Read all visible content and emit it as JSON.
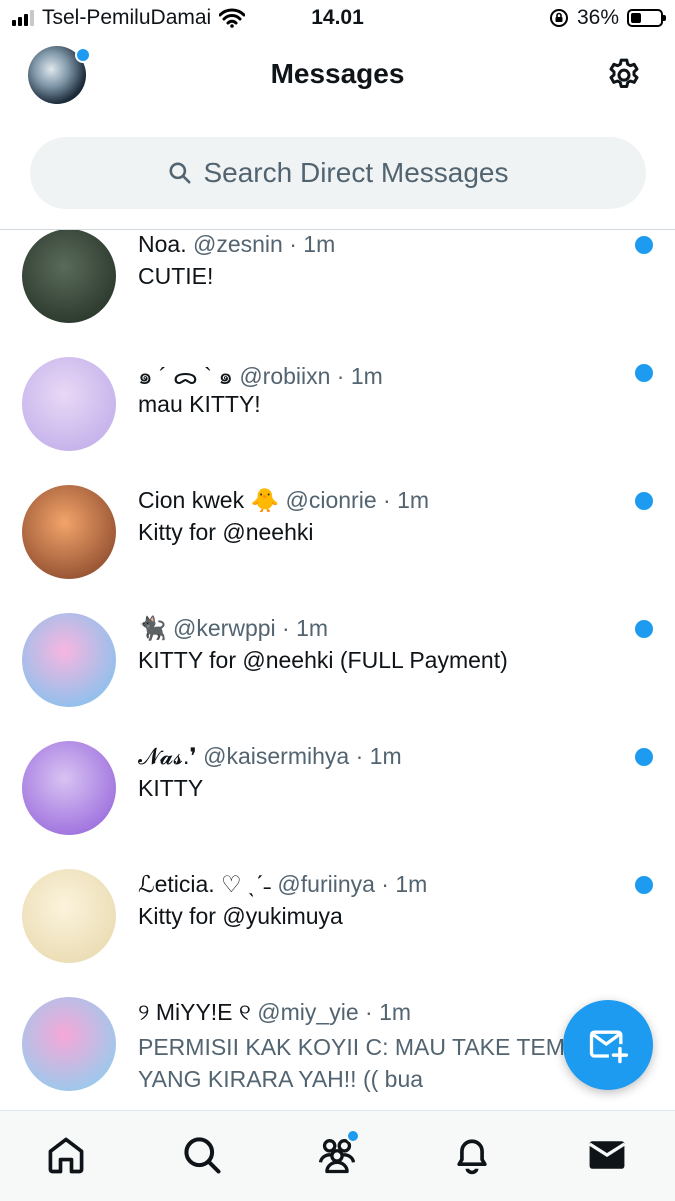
{
  "status_bar": {
    "carrier": "Tsel-PemiluDamai",
    "time": "14.01",
    "battery": "36%",
    "battery_level": 0.36
  },
  "header": {
    "title": "Messages"
  },
  "search": {
    "placeholder": "Search Direct Messages"
  },
  "conversations": [
    {
      "name": "Noa.",
      "handle": "@zesnin",
      "time": "1m",
      "preview": "CUTIE!",
      "unread": true,
      "avatar_colors": [
        "#5a6b5a",
        "#1e2a20"
      ]
    },
    {
      "name": "๑ ´ ᯅ ` ๑",
      "handle": "@robiixn",
      "time": "1m",
      "preview": "mau KITTY!",
      "unread": true,
      "avatar_colors": [
        "#e9d8f5",
        "#b9a7e8"
      ]
    },
    {
      "name": "Cion kwek 🐥",
      "handle": "@cionrie",
      "time": "1m",
      "preview": "Kitty for @neehki",
      "unread": true,
      "avatar_colors": [
        "#f2a46a",
        "#7a3a22"
      ]
    },
    {
      "name": "🐈‍⬛",
      "handle": "@kerwppi",
      "time": "1m",
      "preview": "KITTY for @neehki (FULL Payment)",
      "unread": true,
      "avatar_colors": [
        "#f7b6e0",
        "#6fc3f0"
      ]
    },
    {
      "name": "𝓝𝓪𝓼.❜",
      "handle": "@kaisermihya",
      "time": "1m",
      "preview": "KITTY",
      "unread": true,
      "avatar_colors": [
        "#d8c3f3",
        "#8e5ad8"
      ]
    },
    {
      "name": "ℒeticia. ♡ ˎˊ˗",
      "handle": "@furiinya",
      "time": "1m",
      "preview": "Kitty for @yukimuya",
      "unread": true,
      "avatar_colors": [
        "#fbf3dc",
        "#e6d6a8"
      ]
    },
    {
      "name": "୨ MiYY!E ୧",
      "handle": "@miy_yie",
      "time": "1m",
      "preview": "PERMISII KAK KOYII C: MAU TAKE TEMPLATE YANG KIRARA YAH!! (( bua",
      "unread": false,
      "avatar_colors": [
        "#f7a8d8",
        "#7fd3f2"
      ]
    }
  ],
  "icons": {
    "settings": "gear-icon",
    "search": "search-icon",
    "new_message": "new-message-icon",
    "nav": [
      "home-icon",
      "search-icon",
      "communities-icon",
      "notifications-icon",
      "messages-icon"
    ]
  },
  "colors": {
    "accent": "#1d9bf0",
    "text_secondary": "#536471",
    "search_bg": "#eff3f4"
  }
}
